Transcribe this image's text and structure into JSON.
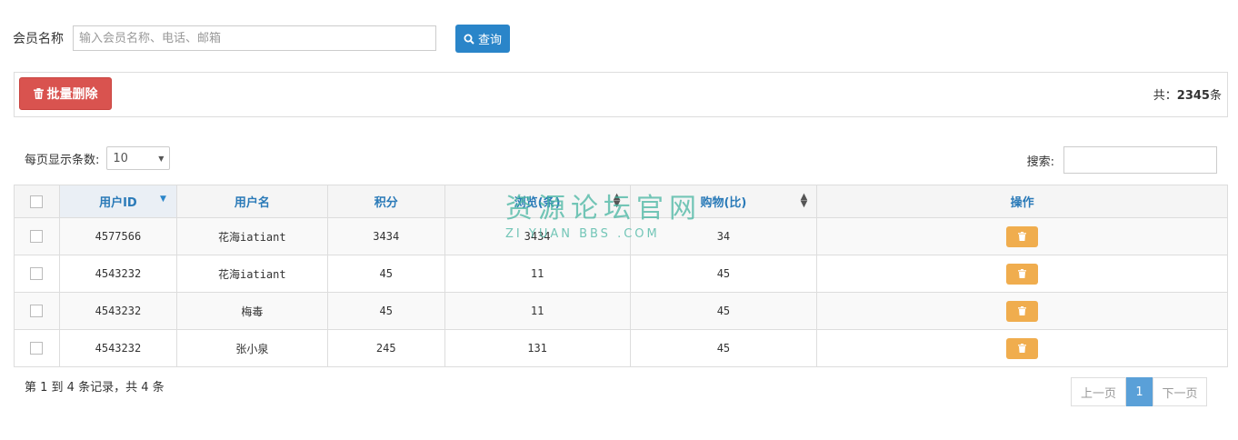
{
  "search": {
    "label": "会员名称",
    "placeholder": "输入会员名称、电话、邮箱",
    "query_button": "查询"
  },
  "toolbar": {
    "batch_delete": "批量删除",
    "total_prefix": "共：",
    "total_count": "2345",
    "total_suffix": "条"
  },
  "list_controls": {
    "per_page_label": "每页显示条数:",
    "per_page_value": "10",
    "search_label": "搜索:"
  },
  "table": {
    "columns": [
      "用户ID",
      "用户名",
      "积分",
      "浏览(条)",
      "购物(比)",
      "操作"
    ],
    "rows": [
      {
        "id": "4577566",
        "name": "花海iatiant",
        "points": "3434",
        "views": "3434",
        "purchases": "34"
      },
      {
        "id": "4543232",
        "name": "花海iatiant",
        "points": "45",
        "views": "11",
        "purchases": "45"
      },
      {
        "id": "4543232",
        "name": "梅毒",
        "points": "45",
        "views": "11",
        "purchases": "45"
      },
      {
        "id": "4543232",
        "name": "张小泉",
        "points": "245",
        "views": "131",
        "purchases": "45"
      }
    ]
  },
  "footer": {
    "info": "第 1 到 4 条记录，共 4 条",
    "prev": "上一页",
    "current": "1",
    "next": "下一页"
  },
  "watermark": {
    "main": "资源论坛官网",
    "sub": "ZI YUAN BBS .COM"
  },
  "colors": {
    "primary": "#2a85c9",
    "danger": "#d9534f",
    "warning": "#f0ad4e",
    "number_text": "#e07b00"
  }
}
